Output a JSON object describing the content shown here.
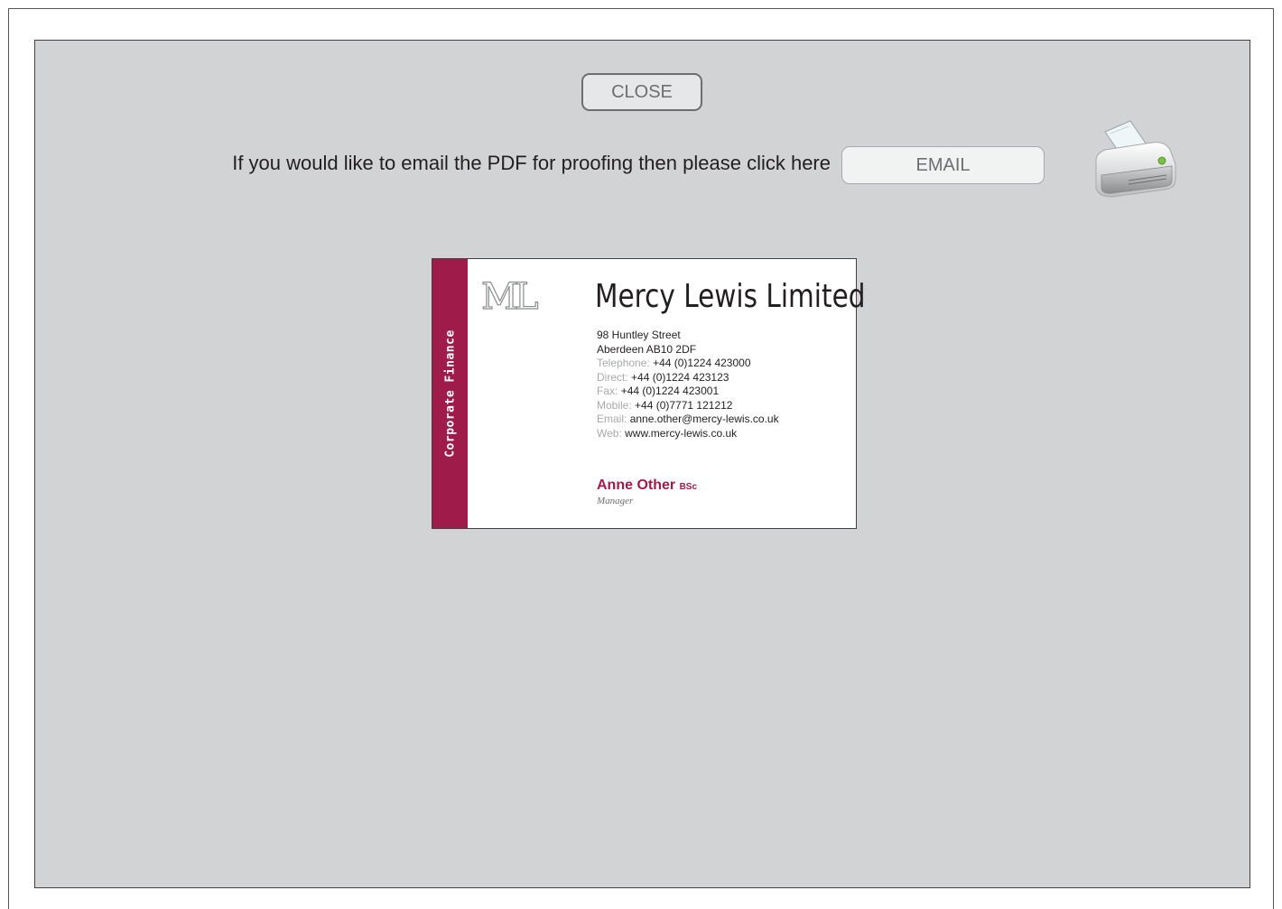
{
  "toolbar": {
    "close_label": "CLOSE",
    "email_prompt": "If you would like to email the PDF for proofing then please click here",
    "email_label": "EMAIL",
    "print_icon": "printer-icon"
  },
  "card": {
    "strip_text": "Corporate  Finance",
    "logo_mark": "ML",
    "company_name": "Mercy Lewis Limited",
    "address_line1": "98 Huntley Street",
    "address_line2": "Aberdeen AB10 2DF",
    "contacts": [
      {
        "label": "Telephone:",
        "value": "+44 (0)1224 423000"
      },
      {
        "label": "Direct:",
        "value": "+44 (0)1224 423123"
      },
      {
        "label": "Fax:",
        "value": "+44 (0)1224 423001"
      },
      {
        "label": "Mobile:",
        "value": "+44 (0)7771 121212"
      },
      {
        "label": "Email:",
        "value": "anne.other@mercy-lewis.co.uk"
      },
      {
        "label": "Web:",
        "value": "www.mercy-lewis.co.uk"
      }
    ],
    "person_name": "Anne Other",
    "person_qualification": "BSc",
    "person_title": "Manager"
  },
  "colors": {
    "panel_bg": "#d1d3d4",
    "brand_accent": "#9e1b4a",
    "text_dark": "#231f20"
  }
}
